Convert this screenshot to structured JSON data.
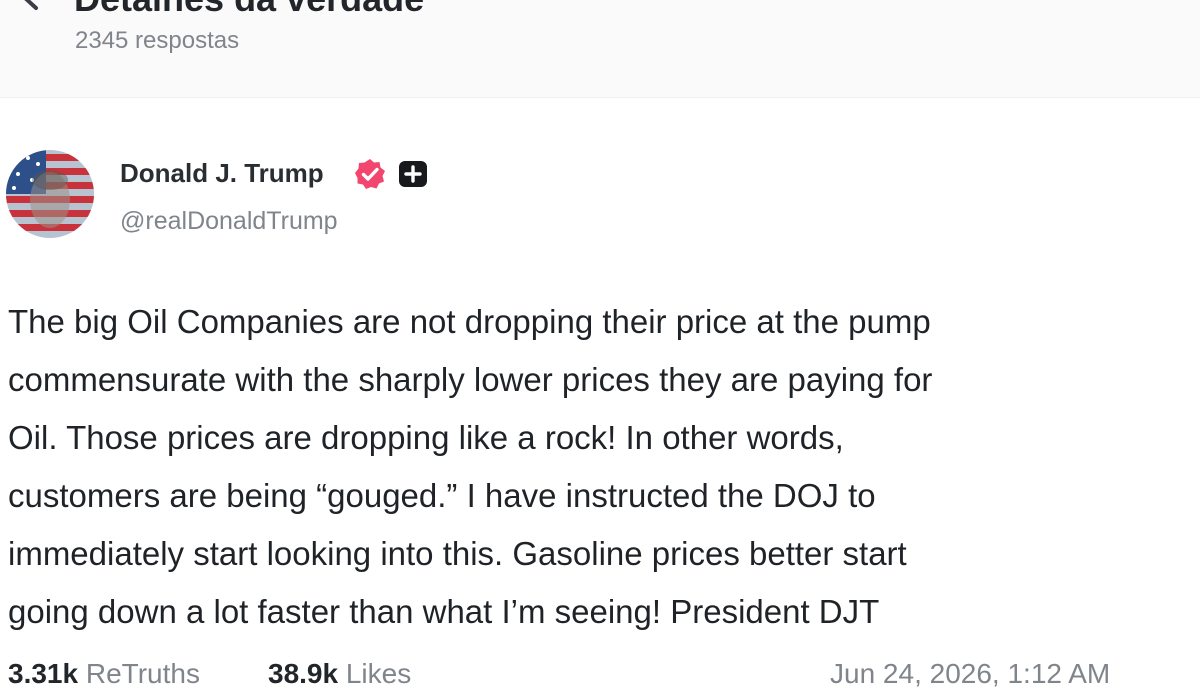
{
  "header": {
    "title": "Detalhes da verdade",
    "reply_count": "2345 respostas"
  },
  "post": {
    "author_name": "Donald J. Trump",
    "handle": "@realDonaldTrump",
    "body": "The big Oil Companies are not dropping their price at the pump\ncommensurate with the sharply lower prices they are paying for\nOil. Those prices are dropping like a rock! In other words,\ncustomers are being “gouged.” I have instructed the DOJ to\nimmediately start looking into this. Gasoline prices better start\ngoing down a lot faster than what I’m seeing! President DJT",
    "icons": {
      "verified": "verified-badge-icon",
      "plus": "plus-badge-icon"
    },
    "accent_color": "#f2466e"
  },
  "stats": {
    "retruths_count": "3.31k",
    "retruths_label": "ReTruths",
    "likes_count": "38.9k",
    "likes_label": "Likes",
    "timestamp": "Jun 24, 2026, 1:12 AM"
  }
}
